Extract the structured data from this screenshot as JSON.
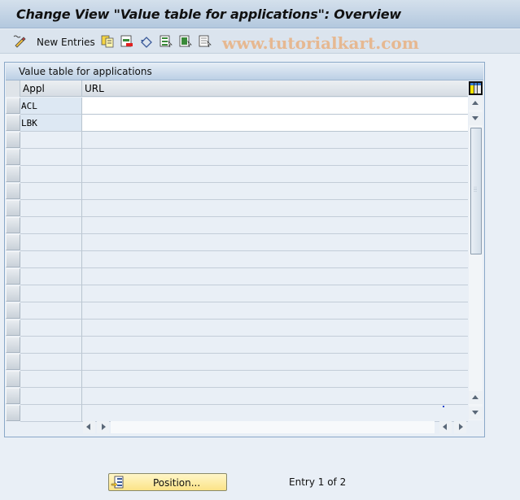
{
  "window": {
    "title": "Change View \"Value table for applications\": Overview"
  },
  "toolbar": {
    "new_entries_label": "New Entries",
    "icons": [
      "change-display-icon",
      "copy-icon",
      "delete-icon",
      "undo-change-icon",
      "select-all-icon",
      "select-block-icon",
      "deselect-all-icon"
    ],
    "watermark": "www.tutorialkart.com"
  },
  "table": {
    "title": "Value table for applications",
    "columns": [
      "Appl",
      "URL"
    ],
    "rows": [
      {
        "appl": "ACL",
        "url": ""
      },
      {
        "appl": "LBK",
        "url": ""
      }
    ],
    "empty_rows": 17
  },
  "footer": {
    "position_button": "Position...",
    "entry_status": "Entry 1 of 2"
  },
  "colors": {
    "title_bg": "#b3c8de",
    "position_button_bg": "#fbe387",
    "watermark": "#e8b487"
  }
}
